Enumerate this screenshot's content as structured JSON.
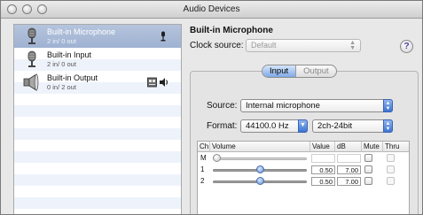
{
  "window": {
    "title": "Audio Devices"
  },
  "devices": [
    {
      "name": "Built-in Microphone",
      "sub": "2 in/ 0 out",
      "icon": "microphone-icon",
      "status": "input-device-icon",
      "selected": true
    },
    {
      "name": "Built-in Input",
      "sub": "2 in/ 0 out",
      "icon": "microphone-icon",
      "status": "",
      "selected": false
    },
    {
      "name": "Built-in Output",
      "sub": "0 in/ 2 out",
      "icon": "speaker-icon",
      "status": "output-device-icon",
      "selected": false
    }
  ],
  "detail": {
    "device_title": "Built-in Microphone",
    "clock_label": "Clock source:",
    "clock_value": "Default",
    "help": "?",
    "tabs": {
      "input": "Input",
      "output": "Output",
      "active": "input"
    },
    "source_label": "Source:",
    "source_value": "Internal microphone",
    "format_label": "Format:",
    "format_rate": "44100.0 Hz",
    "format_depth": "2ch-24bit"
  },
  "table": {
    "headers": {
      "ch": "Ch",
      "volume": "Volume",
      "value": "Value",
      "db": "dB",
      "mute": "Mute",
      "thru": "Thru"
    },
    "rows": [
      {
        "ch": "M",
        "value": "",
        "db": "",
        "volume_fraction": 0.0,
        "mute": false,
        "thru": false,
        "enabled": false
      },
      {
        "ch": "1",
        "value": "0.50",
        "db": "7.00",
        "volume_fraction": 0.5,
        "mute": false,
        "thru": false,
        "enabled": true
      },
      {
        "ch": "2",
        "value": "0.50",
        "db": "7.00",
        "volume_fraction": 0.5,
        "mute": false,
        "thru": false,
        "enabled": true
      }
    ]
  },
  "colors": {
    "selection": "#a9bad7",
    "accent": "#3c74d3"
  }
}
